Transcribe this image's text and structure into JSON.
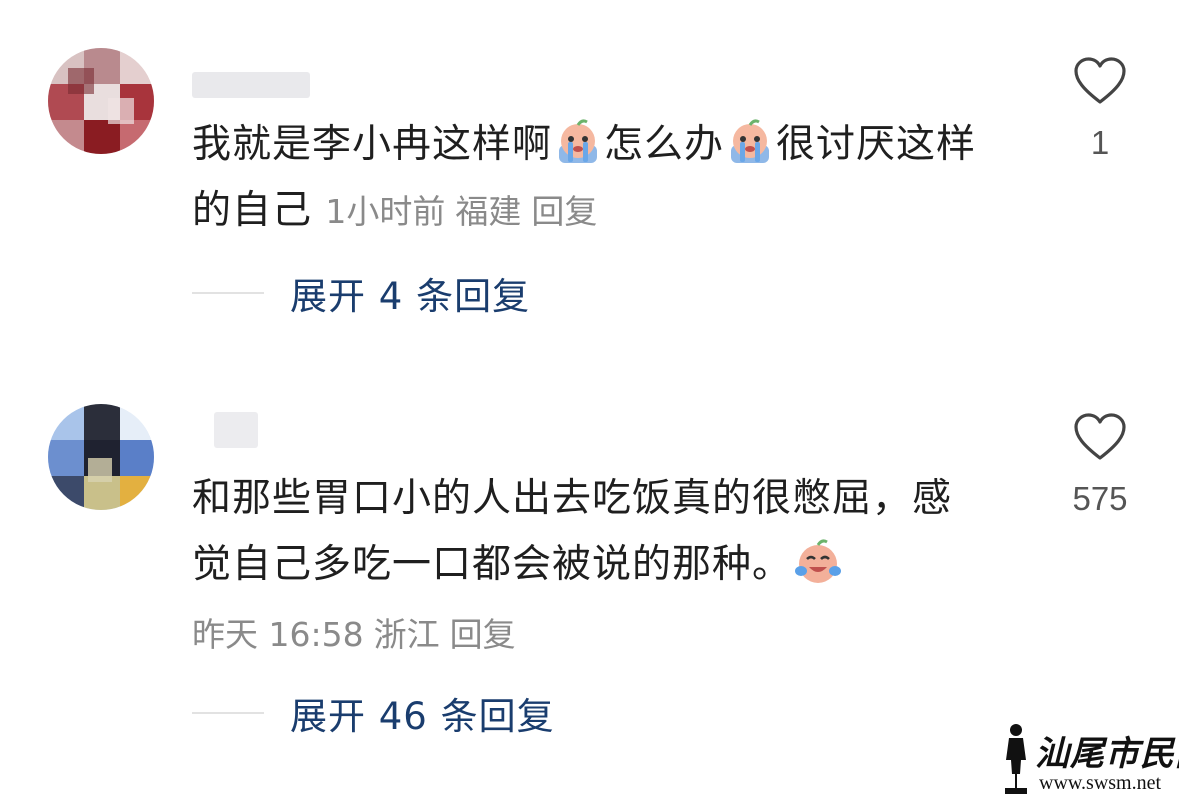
{
  "comments": [
    {
      "text_part1": "我就是李小冉这样啊",
      "text_emoji1": "crying-face-emoji",
      "text_part2": "怎么办",
      "text_emoji2": "crying-face-emoji",
      "text_part3": "很讨厌这样",
      "text_part4": "的自己",
      "time": "1小时前",
      "location": "福建",
      "reply_label": "回复",
      "like_icon": "heart-outline-icon",
      "like_count": "1",
      "expand_label": "展开 4 条回复"
    },
    {
      "text_line1": "和那些胃口小的人出去吃饭真的很憋屈，感",
      "text_line2": "觉自己多吃一口都会被说的那种。",
      "text_emoji": "laughing-crying-face-emoji",
      "time": "昨天 16:58",
      "location": "浙江",
      "reply_label": "回复",
      "like_icon": "heart-outline-icon",
      "like_count": "575",
      "expand_label": "展开 46 条回复"
    }
  ],
  "watermark": {
    "text": "汕尾市民网",
    "url": "www.swsm.net"
  }
}
